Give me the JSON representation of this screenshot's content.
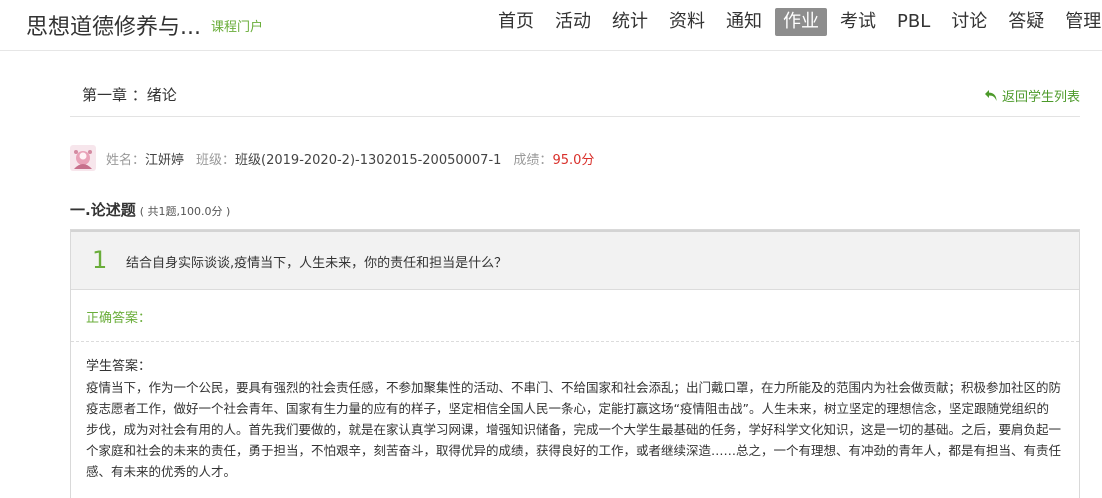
{
  "header": {
    "course_title": "思想道德修养与...",
    "portal_link": "课程门户",
    "nav": [
      {
        "label": "首页",
        "active": false
      },
      {
        "label": "活动",
        "active": false
      },
      {
        "label": "统计",
        "active": false
      },
      {
        "label": "资料",
        "active": false
      },
      {
        "label": "通知",
        "active": false
      },
      {
        "label": "作业",
        "active": true
      },
      {
        "label": "考试",
        "active": false
      },
      {
        "label": "PBL",
        "active": false
      },
      {
        "label": "讨论",
        "active": false
      },
      {
        "label": "答疑",
        "active": false
      },
      {
        "label": "管理",
        "active": false
      }
    ]
  },
  "chapter": {
    "title": "第一章 ：绪论",
    "back_link": "返回学生列表"
  },
  "student": {
    "name_label": "姓名：",
    "name": "江妍婷",
    "class_label": "班级：",
    "class": "班级(2019-2020-2)-1302015-20050007-1",
    "score_label": "成绩：",
    "score": "95.0分"
  },
  "section": {
    "title": "一.论述题",
    "meta": "( 共1题,100.0分 )"
  },
  "question": {
    "number": "1",
    "text": "结合自身实际谈谈,疫情当下，人生未来，你的责任和担当是什么？",
    "correct_label": "正确答案：",
    "student_answer_label": "学生答案：",
    "student_answer": "疫情当下，作为一个公民，要具有强烈的社会责任感，不参加聚集性的活动、不串门、不给国家和社会添乱；出门戴口罩，在力所能及的范围内为社会做贡献；积极参加社区的防疫志愿者工作，做好一个社会青年、国家有生力量的应有的样子，坚定相信全国人民一条心，定能打赢这场“疫情阻击战”。人生未来，树立坚定的理想信念，坚定跟随党组织的步伐，成为对社会有用的人。首先我们要做的，就是在家认真学习网课，增强知识储备，完成一个大学生最基础的任务，学好科学文化知识，这是一切的基础。之后，要肩负起一个家庭和社会的未来的责任，勇于担当，不怕艰辛，刻苦奋斗，取得优异的成绩，获得良好的工作，或者继续深造……总之，一个有理想、有冲劲的青年人，都是有担当、有责任感、有未来的优秀的人才。"
  },
  "colors": {
    "accent_green": "#6aad3a",
    "score_red": "#d9302b",
    "active_nav_bg": "#8d8d8d"
  }
}
